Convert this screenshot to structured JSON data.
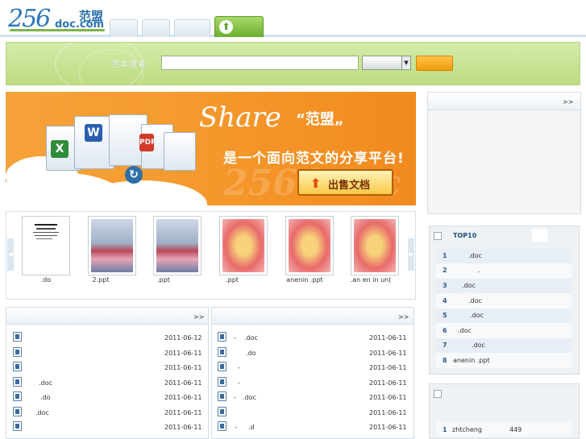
{
  "logo": {
    "number": "256",
    "domain": "doc.com",
    "name_cn": "范盟"
  },
  "search": {
    "label": "范本搜索",
    "placeholder": "",
    "select_value": "",
    "button_label": ""
  },
  "banner": {
    "title": "Share",
    "title_cn": "“范盟„",
    "subtitle": "是一个面向范文的分享平台!",
    "watermark": "256doc.c",
    "sell_button": "出售文档"
  },
  "thumbnails": [
    {
      "label": ".do"
    },
    {
      "label": "2.ppt"
    },
    {
      "label": ".ppt"
    },
    {
      "label": ".ppt"
    },
    {
      "label": "anenin .ppt"
    },
    {
      "label": ".an en in un("
    }
  ],
  "list_left": {
    "more": ">>",
    "rows": [
      {
        "title": "",
        "date": "2011-06-12"
      },
      {
        "title": "",
        "date": "2011-06-11"
      },
      {
        "title": "",
        "date": "2011-06-11"
      },
      {
        "title": ".doc",
        "date": "2011-06-11"
      },
      {
        "title": ".do",
        "date": "2011-06-11"
      },
      {
        "title": ".doc",
        "date": "2011-06-11"
      },
      {
        "title": "",
        "date": "2011-06-11"
      }
    ]
  },
  "list_right": {
    "more": ">>",
    "rows": [
      {
        "prefix": "-",
        "title": ".doc",
        "date": "2011-06-11"
      },
      {
        "prefix": "",
        "title": ".do",
        "date": "2011-06-11"
      },
      {
        "prefix": "-",
        "title": "",
        "date": "2011-06-11"
      },
      {
        "prefix": "-",
        "title": "",
        "date": "2011-06-11"
      },
      {
        "prefix": "-",
        "title": ".doc",
        "date": "2011-06-11"
      },
      {
        "prefix": "",
        "title": "",
        "date": "2011-06-11"
      },
      {
        "prefix": "-",
        "title": ".d",
        "date": "2011-06-11"
      }
    ]
  },
  "right_box": {
    "more": ">>"
  },
  "top10": {
    "title": "TOP10",
    "rows": [
      {
        "n": "1",
        "title": ".doc"
      },
      {
        "n": "2",
        "title": "."
      },
      {
        "n": "3",
        "title": ".doc"
      },
      {
        "n": "4",
        "title": ".doc"
      },
      {
        "n": "5",
        "title": ".doc"
      },
      {
        "n": "6",
        "title": ".doc"
      },
      {
        "n": "7",
        "title": ".doc"
      },
      {
        "n": "8",
        "title": "anenin .ppt"
      }
    ]
  },
  "uploader": {
    "n": "1",
    "name": "zhtcheng",
    "count": "449"
  },
  "colors": {
    "accent_green": "#7fb34a",
    "banner_orange": "#f59b2f",
    "link_blue": "#2a5c90"
  }
}
